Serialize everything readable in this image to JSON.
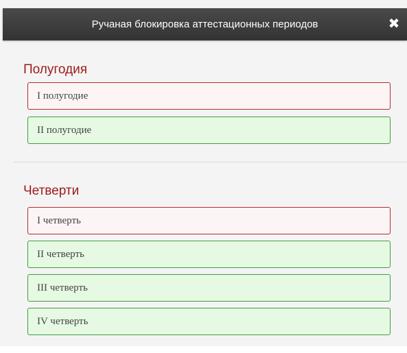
{
  "dialog": {
    "title": "Ручаная блокировка аттестационных периодов",
    "close_glyph": "✖"
  },
  "halfyears": {
    "title": "Полугодия",
    "items": [
      {
        "label": "I полугодие",
        "state": "locked"
      },
      {
        "label": "II полугодие",
        "state": "open"
      }
    ]
  },
  "quarters": {
    "title": "Четверти",
    "items": [
      {
        "label": "I четверть",
        "state": "locked"
      },
      {
        "label": "II четверть",
        "state": "open"
      },
      {
        "label": "III четверть",
        "state": "open"
      },
      {
        "label": "IV четверть",
        "state": "open"
      }
    ]
  },
  "colors": {
    "header_bg": "#3c3c3c",
    "section_title": "#9b1b1b",
    "locked_border": "#b52a2a",
    "locked_bg": "#fdf5f5",
    "open_border": "#3f9e3f",
    "open_bg": "#e6f9e3"
  }
}
